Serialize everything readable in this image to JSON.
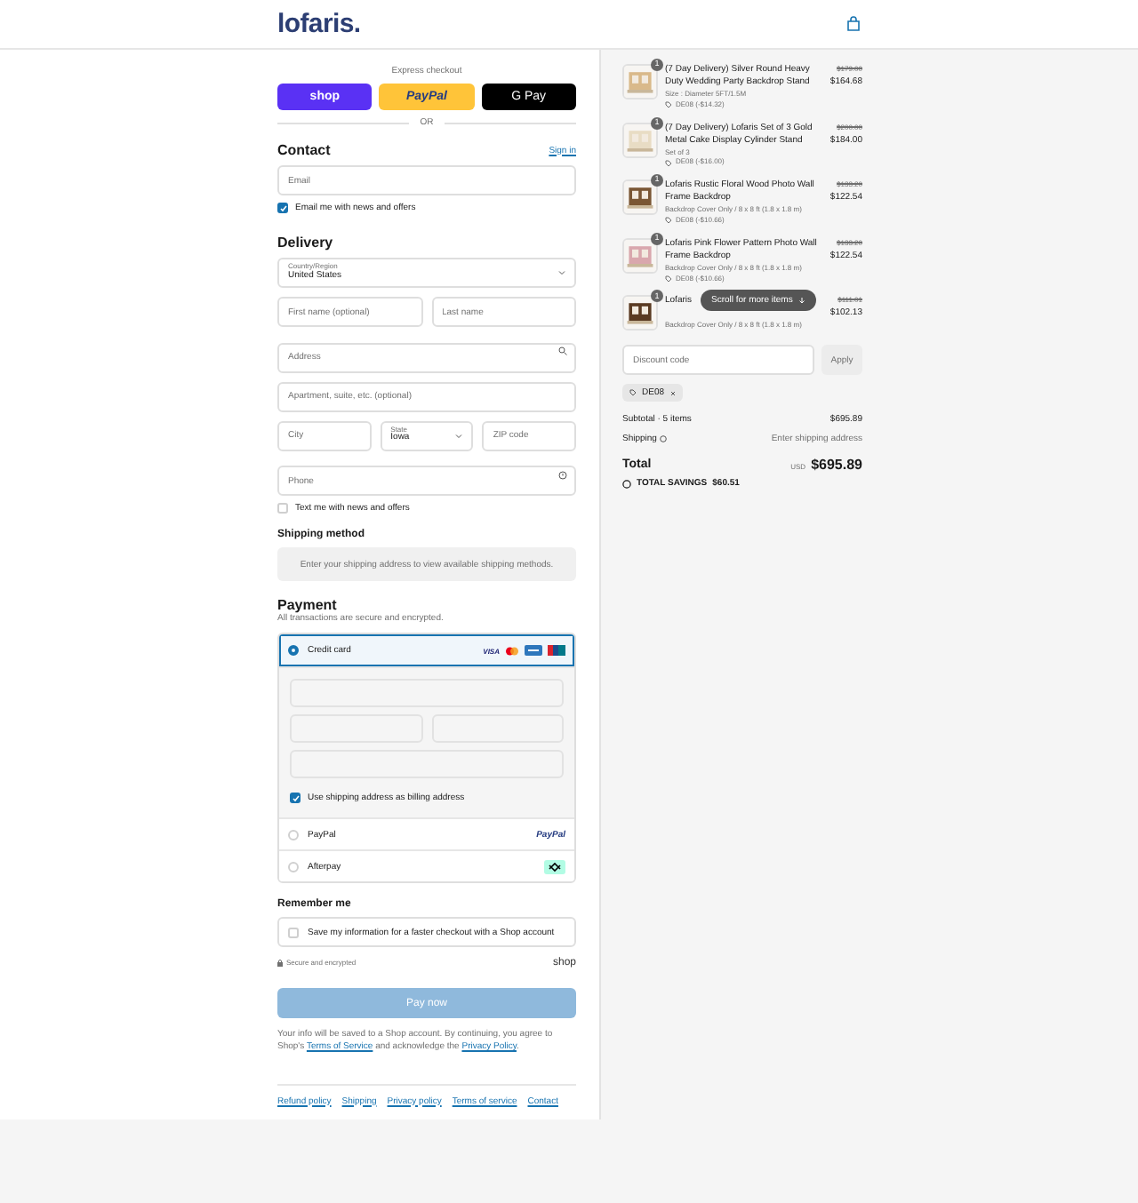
{
  "header": {
    "logo": "lofaris."
  },
  "express": {
    "label": "Express checkout",
    "or": "OR",
    "buttons": [
      {
        "kind": "shop",
        "label": "shop"
      },
      {
        "kind": "paypal",
        "label": "PayPal"
      },
      {
        "kind": "gpay",
        "label": "G Pay"
      }
    ]
  },
  "contact": {
    "title": "Contact",
    "sign_in": "Sign in",
    "email": {
      "placeholder": "Email"
    },
    "newsletter": {
      "label": "Email me with news and offers",
      "checked": true
    }
  },
  "delivery": {
    "title": "Delivery",
    "country": {
      "label": "Country/Region",
      "value": "United States"
    },
    "first_name": {
      "placeholder": "First name (optional)"
    },
    "last_name": {
      "placeholder": "Last name"
    },
    "address": {
      "placeholder": "Address"
    },
    "apartment": {
      "placeholder": "Apartment, suite, etc. (optional)"
    },
    "city": {
      "placeholder": "City"
    },
    "state": {
      "label": "State",
      "value": "Iowa"
    },
    "zip": {
      "placeholder": "ZIP code"
    },
    "phone": {
      "placeholder": "Phone"
    },
    "sms": {
      "label": "Text me with news and offers",
      "checked": false
    }
  },
  "shipping_method": {
    "title": "Shipping method",
    "notice": "Enter your shipping address to view available shipping methods."
  },
  "payment": {
    "title": "Payment",
    "subtitle": "All transactions are secure and encrypted.",
    "visa": "VISA",
    "options": [
      {
        "kind": "card",
        "label": "Credit card",
        "selected": true
      },
      {
        "kind": "paypal",
        "label": "PayPal",
        "logo": "PayPal",
        "selected": false
      },
      {
        "kind": "afterpay",
        "label": "Afterpay",
        "selected": false
      }
    ],
    "billing": {
      "label": "Use shipping address as billing address",
      "checked": true
    }
  },
  "remember": {
    "title": "Remember me",
    "label": "Save my information for a faster checkout with a Shop account",
    "checked": false
  },
  "secure": "Secure and encrypted",
  "shop_logo": "shop",
  "pay_button": "Pay now",
  "legal": {
    "before": "Your info will be saved to a Shop account. By continuing, you agree to Shop's",
    "terms": "Terms of Service",
    "middle": "and acknowledge the",
    "privacy": "Privacy Policy",
    "after": "."
  },
  "footer_links": [
    "Refund policy",
    "Shipping",
    "Privacy policy",
    "Terms of service",
    "Contact"
  ],
  "summary": {
    "items": [
      {
        "qty": "1",
        "title": "(7 Day Delivery) Silver Round Heavy Duty Wedding Party Backdrop Stand",
        "variant": "Size : Diameter 5FT/1.5M",
        "discount": "DE08 (-$14.32)",
        "old_price": "$179.00",
        "price": "$164.68"
      },
      {
        "qty": "1",
        "title": "(7 Day Delivery) Lofaris Set of 3 Gold Metal Cake Display Cylinder Stand",
        "variant": "Set of 3",
        "discount": "DE08 (-$16.00)",
        "old_price": "$200.00",
        "price": "$184.00"
      },
      {
        "qty": "1",
        "title": "Lofaris Rustic Floral Wood Photo Wall Frame Backdrop",
        "variant": "Backdrop Cover Only / 8 x 8 ft (1.8 x 1.8 m)",
        "discount": "DE08 (-$10.66)",
        "old_price": "$133.20",
        "price": "$122.54"
      },
      {
        "qty": "1",
        "title": "Lofaris Pink Flower Pattern Photo Wall Frame Backdrop",
        "variant": "Backdrop Cover Only / 8 x 8 ft (1.8 x 1.8 m)",
        "discount": "DE08 (-$10.66)",
        "old_price": "$133.20",
        "price": "$122.54"
      },
      {
        "qty": "1",
        "title": "Lofaris",
        "variant": "Backdrop Cover Only / 8 x 8 ft (1.8 x 1.8 m)",
        "old_price": "$111.01",
        "price": "$102.13"
      }
    ],
    "scroll_hint": "Scroll for more items",
    "discount_placeholder": "Discount code",
    "apply": "Apply",
    "code": "DE08",
    "subtotal_label": "Subtotal · 5 items",
    "subtotal": "$695.89",
    "shipping_label": "Shipping",
    "shipping_value": "Enter shipping address",
    "total_label": "Total",
    "currency": "USD",
    "total": "$695.89",
    "savings_label": "TOTAL SAVINGS",
    "savings": "$60.51"
  }
}
